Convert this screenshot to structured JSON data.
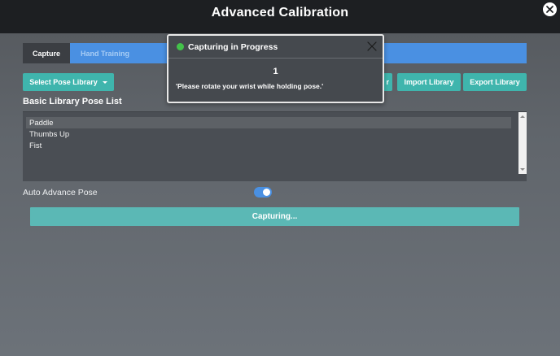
{
  "window": {
    "title": "Advanced Calibration",
    "close_icon": "close-circle-icon"
  },
  "tabs": [
    {
      "label": "Capture",
      "active": true
    },
    {
      "label": "Hand Training",
      "active": false
    }
  ],
  "toolbar": {
    "select_library_label": "Select Pose Library",
    "partial_hidden_label": "r",
    "import_label": "Import Library",
    "export_label": "Export Library"
  },
  "library": {
    "title": "Basic Library Pose List",
    "items": [
      "Paddle",
      "Thumbs Up",
      "Fist"
    ],
    "selected_index": 0
  },
  "auto_advance": {
    "label": "Auto Advance Pose",
    "enabled": true
  },
  "capture_button": {
    "label": "Capturing..."
  },
  "dialog": {
    "title": "Capturing in Progress",
    "status_color": "#43c24a",
    "count": "1",
    "message": "'Please rotate your wrist while holding pose.'"
  },
  "colors": {
    "accent_blue": "#4a90e2",
    "teal_button": "#3fb5ad",
    "capture_bar": "#5bb8b5",
    "titlebar": "#1d1f22"
  }
}
